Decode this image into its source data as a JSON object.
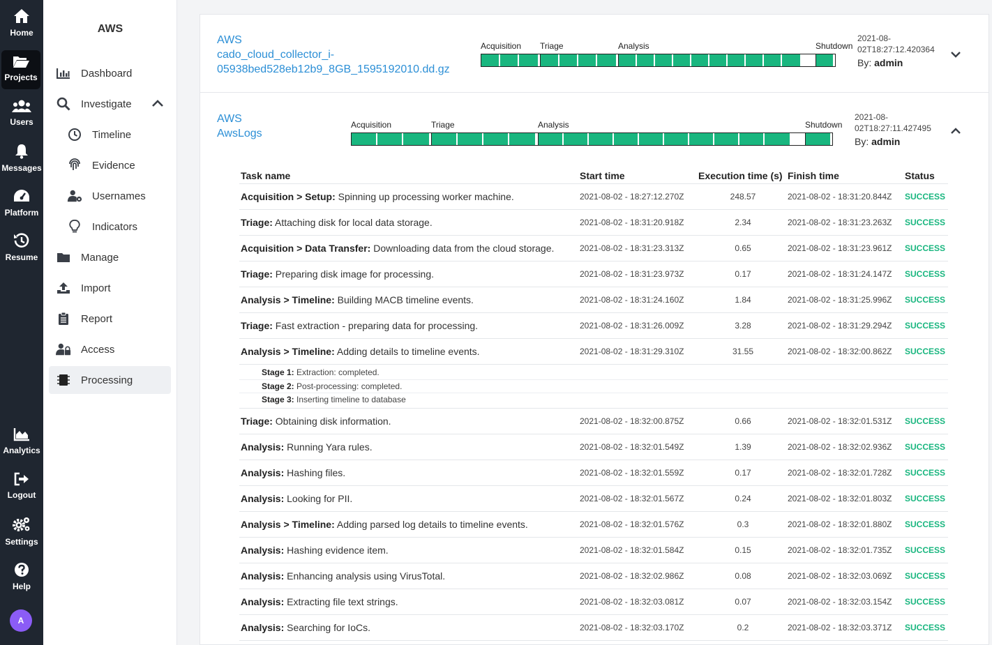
{
  "rail": {
    "items": [
      {
        "label": "Home",
        "icon": "home-icon"
      },
      {
        "label": "Projects",
        "icon": "folder-open-icon"
      },
      {
        "label": "Users",
        "icon": "users-icon"
      },
      {
        "label": "Messages",
        "icon": "bell-icon"
      },
      {
        "label": "Platform",
        "icon": "gauge-icon"
      },
      {
        "label": "Resume",
        "icon": "history-icon"
      },
      {
        "label": "Analytics",
        "icon": "area-chart-icon"
      },
      {
        "label": "Logout",
        "icon": "logout-icon"
      },
      {
        "label": "Settings",
        "icon": "gears-icon"
      },
      {
        "label": "Help",
        "icon": "help-icon"
      }
    ],
    "active": "Projects",
    "avatar": "A"
  },
  "subnav": {
    "title": "AWS",
    "items": [
      {
        "label": "Dashboard",
        "icon": "bar-chart-icon"
      },
      {
        "label": "Investigate",
        "icon": "search-icon"
      },
      {
        "label": "Timeline",
        "icon": "clock-icon"
      },
      {
        "label": "Evidence",
        "icon": "fingerprint-icon"
      },
      {
        "label": "Usernames",
        "icon": "user-gear-icon"
      },
      {
        "label": "Indicators",
        "icon": "lightbulb-icon"
      },
      {
        "label": "Manage",
        "icon": "folder-icon"
      },
      {
        "label": "Import",
        "icon": "upload-icon"
      },
      {
        "label": "Report",
        "icon": "clipboard-icon"
      },
      {
        "label": "Access",
        "icon": "user-lock-icon"
      },
      {
        "label": "Processing",
        "icon": "processor-icon"
      }
    ],
    "active": "Processing"
  },
  "jobs": [
    {
      "title_line1": "AWS",
      "title_line2": "cado_cloud_collector_i-",
      "title_line3": "05938bed528eb12b9_8GB_1595192010.dd.gz",
      "stages": [
        "Acquisition",
        "Triage",
        "Analysis",
        "Shutdown"
      ],
      "progress": 1.0,
      "timestamp_line1": "2021-08-",
      "timestamp_line2": "02T18:27:12.420364",
      "by_label": "By:",
      "by_user": "admin",
      "expanded": false
    },
    {
      "title_line1": "AWS",
      "title_line2": "AwsLogs",
      "stages": [
        "Acquisition",
        "Triage",
        "Analysis",
        "Shutdown"
      ],
      "progress": 1.0,
      "timestamp_line1": "2021-08-",
      "timestamp_line2": "02T18:27:11.427495",
      "by_label": "By:",
      "by_user": "admin",
      "expanded": true
    }
  ],
  "table": {
    "headers": {
      "name": "Task name",
      "start": "Start time",
      "exec": "Execution time (s)",
      "finish": "Finish time",
      "status": "Status"
    },
    "rows": [
      {
        "prefix": "Acquisition > Setup:",
        "desc": " Spinning up processing worker machine.",
        "start": "2021-08-02 - 18:27:12.270Z",
        "exec": "248.57",
        "finish": "2021-08-02 - 18:31:20.844Z",
        "status": "SUCCESS"
      },
      {
        "prefix": "Triage:",
        "desc": " Attaching disk for local data storage.",
        "start": "2021-08-02 - 18:31:20.918Z",
        "exec": "2.34",
        "finish": "2021-08-02 - 18:31:23.263Z",
        "status": "SUCCESS"
      },
      {
        "prefix": "Acquisition > Data Transfer:",
        "desc": " Downloading data from the cloud storage.",
        "start": "2021-08-02 - 18:31:23.313Z",
        "exec": "0.65",
        "finish": "2021-08-02 - 18:31:23.961Z",
        "status": "SUCCESS"
      },
      {
        "prefix": "Triage:",
        "desc": " Preparing disk image for processing.",
        "start": "2021-08-02 - 18:31:23.973Z",
        "exec": "0.17",
        "finish": "2021-08-02 - 18:31:24.147Z",
        "status": "SUCCESS"
      },
      {
        "prefix": "Analysis > Timeline:",
        "desc": " Building MACB timeline events.",
        "start": "2021-08-02 - 18:31:24.160Z",
        "exec": "1.84",
        "finish": "2021-08-02 - 18:31:25.996Z",
        "status": "SUCCESS"
      },
      {
        "prefix": "Triage:",
        "desc": " Fast extraction - preparing data for processing.",
        "start": "2021-08-02 - 18:31:26.009Z",
        "exec": "3.28",
        "finish": "2021-08-02 - 18:31:29.294Z",
        "status": "SUCCESS"
      },
      {
        "prefix": "Analysis > Timeline:",
        "desc": " Adding details to timeline events.",
        "start": "2021-08-02 - 18:31:29.310Z",
        "exec": "31.55",
        "finish": "2021-08-02 - 18:32:00.862Z",
        "status": "SUCCESS"
      },
      {
        "prefix": "Triage:",
        "desc": " Obtaining disk information.",
        "start": "2021-08-02 - 18:32:00.875Z",
        "exec": "0.66",
        "finish": "2021-08-02 - 18:32:01.531Z",
        "status": "SUCCESS"
      },
      {
        "prefix": "Analysis:",
        "desc": " Running Yara rules.",
        "start": "2021-08-02 - 18:32:01.549Z",
        "exec": "1.39",
        "finish": "2021-08-02 - 18:32:02.936Z",
        "status": "SUCCESS"
      },
      {
        "prefix": "Analysis:",
        "desc": " Hashing files.",
        "start": "2021-08-02 - 18:32:01.559Z",
        "exec": "0.17",
        "finish": "2021-08-02 - 18:32:01.728Z",
        "status": "SUCCESS"
      },
      {
        "prefix": "Analysis:",
        "desc": " Looking for PII.",
        "start": "2021-08-02 - 18:32:01.567Z",
        "exec": "0.24",
        "finish": "2021-08-02 - 18:32:01.803Z",
        "status": "SUCCESS"
      },
      {
        "prefix": "Analysis > Timeline:",
        "desc": " Adding parsed log details to timeline events.",
        "start": "2021-08-02 - 18:32:01.576Z",
        "exec": "0.3",
        "finish": "2021-08-02 - 18:32:01.880Z",
        "status": "SUCCESS"
      },
      {
        "prefix": "Analysis:",
        "desc": " Hashing evidence item.",
        "start": "2021-08-02 - 18:32:01.584Z",
        "exec": "0.15",
        "finish": "2021-08-02 - 18:32:01.735Z",
        "status": "SUCCESS"
      },
      {
        "prefix": "Analysis:",
        "desc": " Enhancing analysis using VirusTotal.",
        "start": "2021-08-02 - 18:32:02.986Z",
        "exec": "0.08",
        "finish": "2021-08-02 - 18:32:03.069Z",
        "status": "SUCCESS"
      },
      {
        "prefix": "Analysis:",
        "desc": " Extracting file text strings.",
        "start": "2021-08-02 - 18:32:03.081Z",
        "exec": "0.07",
        "finish": "2021-08-02 - 18:32:03.154Z",
        "status": "SUCCESS"
      },
      {
        "prefix": "Analysis:",
        "desc": " Searching for IoCs.",
        "start": "2021-08-02 - 18:32:03.170Z",
        "exec": "0.2",
        "finish": "2021-08-02 - 18:32:03.371Z",
        "status": "SUCCESS"
      }
    ],
    "stage_details": [
      {
        "label": "Stage 1:",
        "text": " Extraction: completed."
      },
      {
        "label": "Stage 2:",
        "text": " Post-processing: completed."
      },
      {
        "label": "Stage 3:",
        "text": " Inserting timeline to database"
      }
    ]
  },
  "colors": {
    "rail_bg": "#1f2630",
    "accent_link": "#2c8fd6",
    "success": "#19b67f",
    "avatar": "#8b5cf6"
  }
}
